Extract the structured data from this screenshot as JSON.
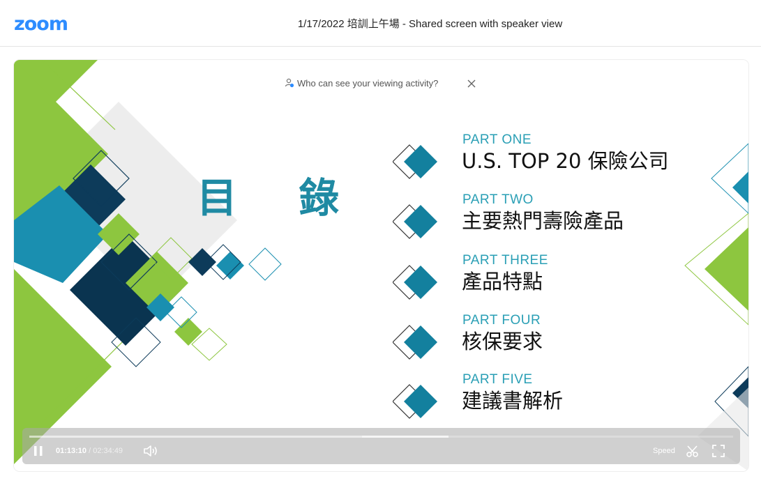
{
  "app": {
    "logo_text": "zoom",
    "brand_color": "#2d8cff"
  },
  "header": {
    "title": "1/17/2022 培訓上午場 - Shared screen with speaker view"
  },
  "privacy_notice": {
    "text": "Who can see your viewing activity?",
    "icon": "person-shield-icon",
    "close_icon": "close-icon"
  },
  "slide": {
    "heading": "目 錄",
    "accent_color": "#1f8aa3",
    "items": [
      {
        "part": "PART ONE",
        "title": "U.S. TOP 20 保險公司"
      },
      {
        "part": "PART TWO",
        "title": "主要熱門壽險產品"
      },
      {
        "part": "PART THREE",
        "title": "產品特點"
      },
      {
        "part": "PART FOUR",
        "title": "核保要求"
      },
      {
        "part": "PART FIVE",
        "title": "建議書解析"
      }
    ]
  },
  "player": {
    "current_time": "01:13:10",
    "separator": "/",
    "duration": "02:34:49",
    "progress_fraction": 0.4723,
    "buffer_end_fraction": 0.596,
    "speed_label": "Speed",
    "icons": {
      "play_pause": "pause-icon",
      "volume": "volume-icon",
      "clip": "scissors-icon",
      "fullscreen": "fullscreen-icon"
    }
  }
}
